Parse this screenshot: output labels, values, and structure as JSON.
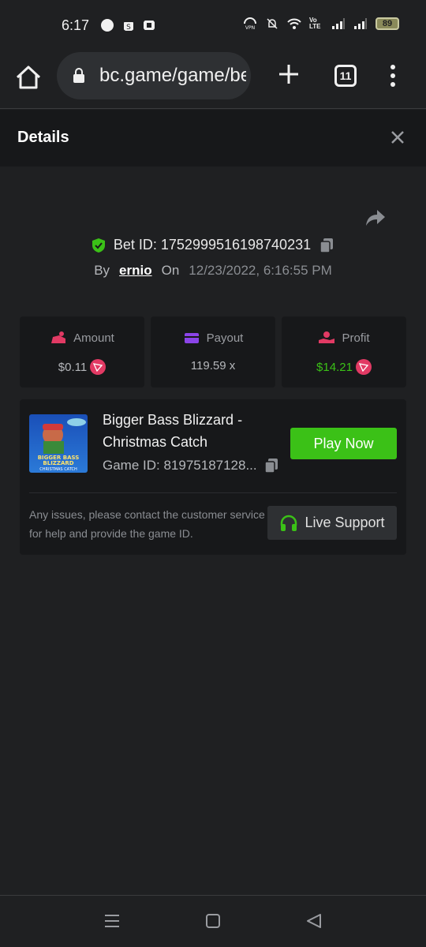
{
  "status_bar": {
    "time": "6:17",
    "battery": "89",
    "volte": "Vo LTE"
  },
  "browser": {
    "url": "bc.game/game/bet",
    "tab_count": "11"
  },
  "details": {
    "title": "Details"
  },
  "bet": {
    "id_label": "Bet ID: 1752999516198740231",
    "by_label": "By",
    "user": "ernio",
    "on_label": "On",
    "datetime": "12/23/2022, 6:16:55 PM"
  },
  "stats": {
    "amount": {
      "label": "Amount",
      "value": "$0.11"
    },
    "payout": {
      "label": "Payout",
      "value": "119.59 x"
    },
    "profit": {
      "label": "Profit",
      "value": "$14.21"
    }
  },
  "game": {
    "name": "Bigger Bass Blizzard - Christmas Catch",
    "thumb_text_1": "BIGGER BASS",
    "thumb_text_2": "BLIZZARD",
    "thumb_text_3": "CHRISTMAS CATCH",
    "id_label": "Game ID: 81975187128...",
    "play_label": "Play Now"
  },
  "support": {
    "text": "Any issues, please contact the customer service for help and provide the game ID.",
    "button_label": "Live Support"
  },
  "colors": {
    "accent_green": "#3bc117",
    "coin_red": "#e23a64"
  }
}
